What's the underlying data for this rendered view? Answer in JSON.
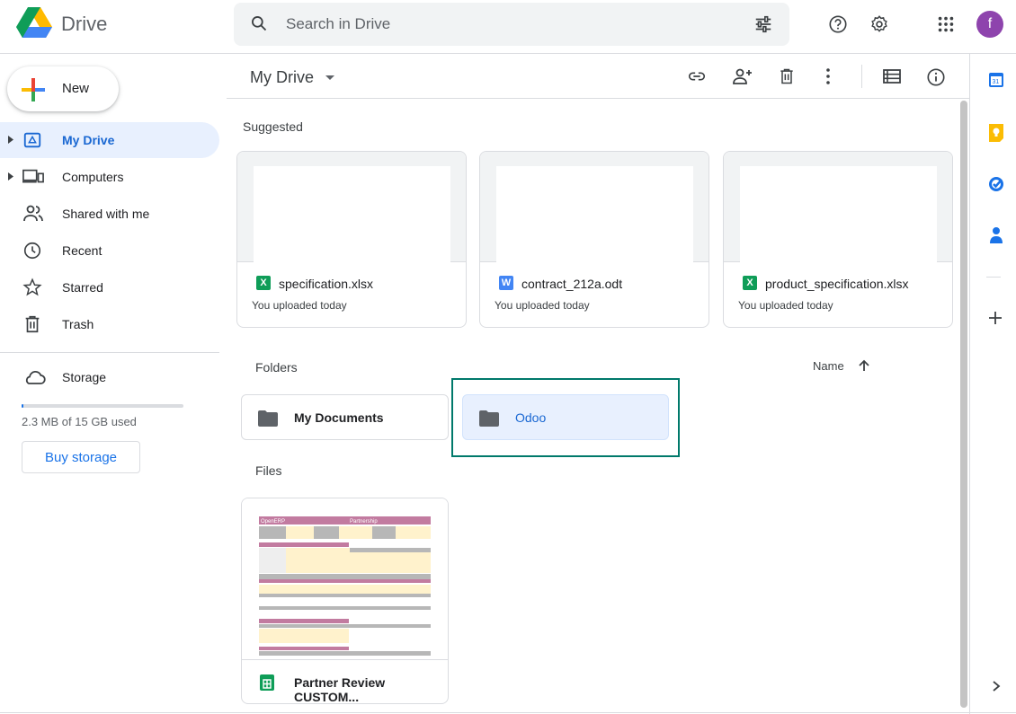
{
  "header": {
    "brand": "Drive",
    "search_placeholder": "Search in Drive",
    "avatar_letter": "f",
    "avatar_color": "#8e44ad"
  },
  "sidebar": {
    "new_label": "New",
    "items": [
      {
        "label": "My Drive",
        "icon": "my-drive-icon",
        "active": true
      },
      {
        "label": "Computers",
        "icon": "computers-icon"
      },
      {
        "label": "Shared with me",
        "icon": "shared-icon"
      },
      {
        "label": "Recent",
        "icon": "clock-icon"
      },
      {
        "label": "Starred",
        "icon": "star-icon"
      },
      {
        "label": "Trash",
        "icon": "trash-icon"
      }
    ],
    "storage_label": "Storage",
    "storage_used": "2.3 MB of 15 GB used",
    "storage_fraction": 0.0002,
    "buy_label": "Buy storage"
  },
  "main": {
    "title": "My Drive",
    "suggested_label": "Suggested",
    "suggested": [
      {
        "name": "specification.xlsx",
        "sub": "You uploaded today",
        "type": "X",
        "color": "#0f9d58"
      },
      {
        "name": "contract_212a.odt",
        "sub": "You uploaded today",
        "type": "W",
        "color": "#4285f4"
      },
      {
        "name": "product_specification.xlsx",
        "sub": "You uploaded today",
        "type": "X",
        "color": "#0f9d58"
      }
    ],
    "folders_label": "Folders",
    "sort_label": "Name",
    "folders": [
      {
        "name": "My Documents"
      },
      {
        "name": "Odoo",
        "selected": true
      }
    ],
    "files_label": "Files",
    "files": [
      {
        "name": "Partner Review CUSTOM..."
      }
    ],
    "thumb_text": {
      "left": "OpenERP",
      "right": "Partnership"
    }
  },
  "colors": {
    "accent": "#1a73e8",
    "selected_bg": "#e8f0fe",
    "highlight_border": "#00796b"
  }
}
